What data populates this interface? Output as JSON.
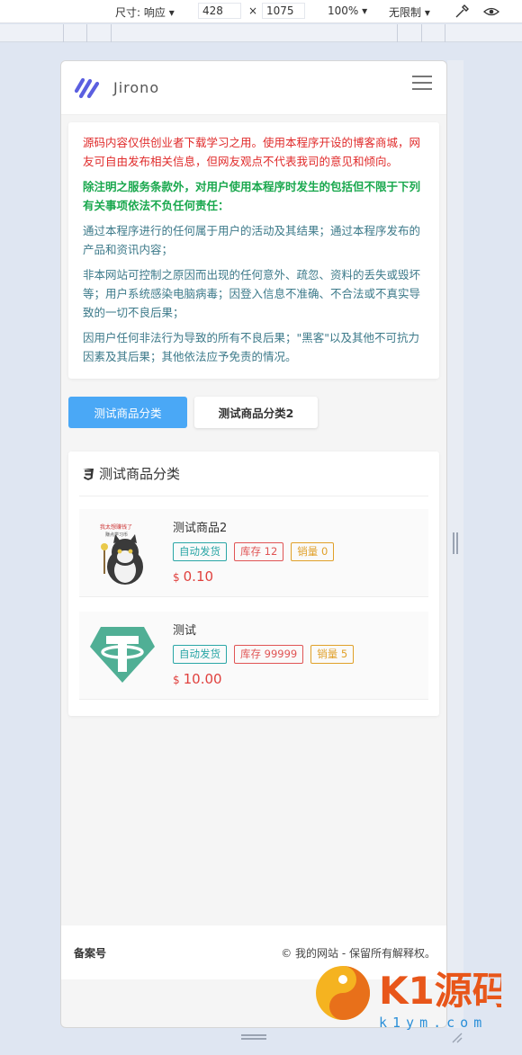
{
  "devtools": {
    "size_label": "尺寸: 响应",
    "width": "428",
    "times": "×",
    "height": "1075",
    "zoom": "100%",
    "throttle": "无限制"
  },
  "header": {
    "brand": "Jirono",
    "logo_icon": "slash-stripes-logo",
    "menu_icon": "hamburger-icon"
  },
  "notice": {
    "p1": "源码内容仅供创业者下载学习之用。使用本程序开设的博客商城，网友可自由发布相关信息，但网友观点不代表我司的意见和倾向。",
    "p2": "除注明之服务条款外，对用户使用本程序时发生的包括但不限于下列有关事项依法不负任何责任：",
    "p3": "通过本程序进行的任何属于用户的活动及其结果；通过本程序发布的产品和资讯内容；",
    "p4": "非本网站可控制之原因而出现的任何意外、疏忽、资料的丢失或毁坏等；用户系统感染电脑病毒；因登入信息不准确、不合法或不真实导致的一切不良后果；",
    "p5": "因用户任何非法行为导致的所有不良后果；\"黑客\"以及其他不可抗力因素及其后果；其他依法应予免责的情况。"
  },
  "tabs": [
    {
      "label": "测试商品分类"
    },
    {
      "label": "测试商品分类2"
    }
  ],
  "category": {
    "title": "测试商品分类",
    "icon": "css3-icon"
  },
  "products": [
    {
      "name": "测试商品2",
      "tag_auto": "自动发货",
      "tag_stock": "库存 12",
      "tag_sales": "销量 0",
      "currency": "$",
      "price": "0.10",
      "image": "cartoon-cat-image"
    },
    {
      "name": "测试",
      "tag_auto": "自动发货",
      "tag_stock": "库存 99999",
      "tag_sales": "销量 5",
      "currency": "$",
      "price": "10.00",
      "image": "tether-logo"
    }
  ],
  "footer": {
    "beian": "备案号",
    "copyright": "© 我的网站 - 保留所有解释权。"
  },
  "watermark": {
    "main": "K1源码",
    "url": "k1ym.com"
  },
  "colors": {
    "accent_blue": "#4aa8f6",
    "price_red": "#e0413e",
    "tag_green": "#2aa6a6",
    "tag_red": "#e05454",
    "tag_orange": "#e0a028"
  }
}
